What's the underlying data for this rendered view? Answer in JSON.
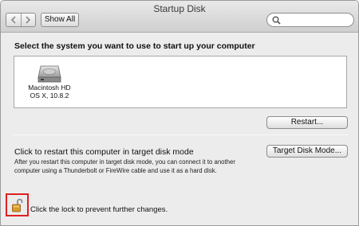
{
  "window": {
    "title": "Startup Disk"
  },
  "toolbar": {
    "show_all_label": "Show All",
    "back_icon": "chevron-left-icon",
    "forward_icon": "chevron-right-icon",
    "search_placeholder": "",
    "search_icon": "magnifier-icon"
  },
  "main": {
    "heading": "Select the system you want to use to start up your computer",
    "disks": [
      {
        "name": "Macintosh HD",
        "system": "OS X, 10.8.2",
        "icon": "hard-disk-icon"
      }
    ],
    "restart_button": "Restart...",
    "target_mode": {
      "heading": "Click to restart this computer in target disk mode",
      "description": "After you restart this computer in target disk mode, you can connect it to another computer using a Thunderbolt or FireWire cable and use it as a hard disk.",
      "button": "Target Disk Mode..."
    },
    "lock": {
      "text": "Click the lock to prevent further changes.",
      "icon": "unlocked-padlock-icon",
      "highlight_color": "#e02020"
    }
  }
}
